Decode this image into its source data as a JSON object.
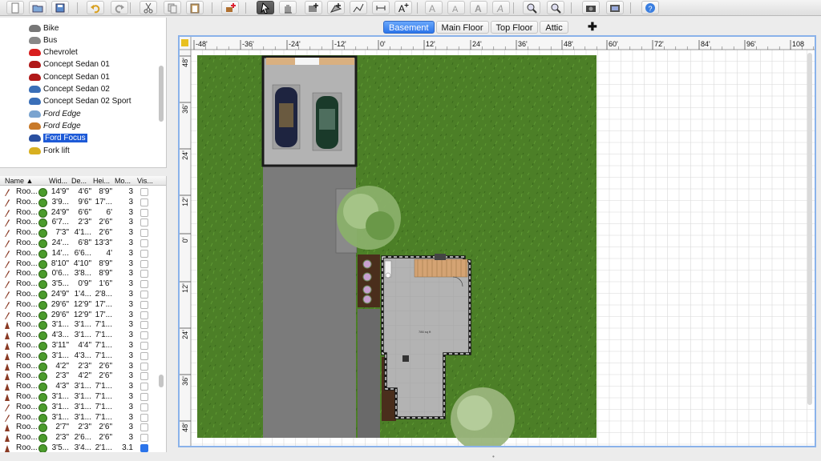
{
  "toolbar": {
    "icons": [
      "new-file-icon",
      "open-folder-icon",
      "save-icon",
      "undo-icon",
      "redo-icon",
      "cut-icon",
      "copy-icon",
      "paste-icon",
      "add-furniture-icon",
      "select-pointer-icon",
      "pan-hand-icon",
      "create-walls-icon",
      "create-rooms-icon",
      "create-polylines-icon",
      "create-dimensions-icon",
      "add-text-icon",
      "increase-text-icon",
      "decrease-text-icon",
      "bold-text-icon",
      "italic-text-icon",
      "zoom-in-icon",
      "zoom-out-icon",
      "create-photo-icon",
      "create-video-icon",
      "help-icon"
    ]
  },
  "catalog": {
    "items": [
      {
        "label": "Bike",
        "color": "#777777",
        "italic": false,
        "selected": false
      },
      {
        "label": "Bus",
        "color": "#888888",
        "italic": false,
        "selected": false
      },
      {
        "label": "Chevrolet",
        "color": "#d81e1e",
        "italic": false,
        "selected": false
      },
      {
        "label": "Concept Sedan 01",
        "color": "#b01818",
        "italic": false,
        "selected": false
      },
      {
        "label": "Concept Sedan 01",
        "color": "#b01818",
        "italic": false,
        "selected": false
      },
      {
        "label": "Concept Sedan 02",
        "color": "#3a6fb8",
        "italic": false,
        "selected": false
      },
      {
        "label": "Concept Sedan 02 Sport",
        "color": "#3a6fb8",
        "italic": false,
        "selected": false
      },
      {
        "label": "Ford Edge",
        "color": "#7aa4d0",
        "italic": true,
        "selected": false
      },
      {
        "label": "Ford Edge",
        "color": "#c87a2a",
        "italic": true,
        "selected": false
      },
      {
        "label": "Ford Focus",
        "color": "#2a50a0",
        "italic": false,
        "selected": true
      },
      {
        "label": "Fork lift",
        "color": "#d8b020",
        "italic": false,
        "selected": false
      }
    ]
  },
  "furniture": {
    "columns": [
      "Name ▲",
      "Wid...",
      "De...",
      "Hei...",
      "Mo...",
      "Vis..."
    ],
    "rows": [
      {
        "name": "Roo...",
        "w": "14'9\"",
        "d": "4'6\"",
        "h": "8'9\"",
        "m": "3",
        "v": false
      },
      {
        "name": "Roo...",
        "w": "3'9...",
        "d": "9'6\"",
        "h": "17'...",
        "m": "3",
        "v": false
      },
      {
        "name": "Roo...",
        "w": "24'9\"",
        "d": "6'6\"",
        "h": "6'",
        "m": "3",
        "v": false
      },
      {
        "name": "Roo...",
        "w": "6'7...",
        "d": "2'3\"",
        "h": "2'6\"",
        "m": "3",
        "v": false
      },
      {
        "name": "Roo...",
        "w": "7'3\"",
        "d": "4'1...",
        "h": "2'6\"",
        "m": "3",
        "v": false
      },
      {
        "name": "Roo...",
        "w": "24'...",
        "d": "6'8\"",
        "h": "13'3\"",
        "m": "3",
        "v": false
      },
      {
        "name": "Roo...",
        "w": "14'...",
        "d": "6'6...",
        "h": "4'",
        "m": "3",
        "v": false
      },
      {
        "name": "Roo...",
        "w": "8'10\"",
        "d": "4'10\"",
        "h": "8'9\"",
        "m": "3",
        "v": false
      },
      {
        "name": "Roo...",
        "w": "0'6...",
        "d": "3'8...",
        "h": "8'9\"",
        "m": "3",
        "v": false
      },
      {
        "name": "Roo...",
        "w": "3'5...",
        "d": "0'9\"",
        "h": "1'6\"",
        "m": "3",
        "v": false
      },
      {
        "name": "Roo...",
        "w": "24'9\"",
        "d": "1'4...",
        "h": "2'8...",
        "m": "3",
        "v": false
      },
      {
        "name": "Roo...",
        "w": "29'6\"",
        "d": "12'9\"",
        "h": "17'...",
        "m": "3",
        "v": false
      },
      {
        "name": "Roo...",
        "w": "29'6\"",
        "d": "12'9\"",
        "h": "17'...",
        "m": "3",
        "v": false
      },
      {
        "name": "Roo...",
        "w": "3'1...",
        "d": "3'1...",
        "h": "7'1...",
        "m": "3",
        "v": false
      },
      {
        "name": "Roo...",
        "w": "4'3...",
        "d": "3'1...",
        "h": "7'1...",
        "m": "3",
        "v": false
      },
      {
        "name": "Roo...",
        "w": "3'11\"",
        "d": "4'4\"",
        "h": "7'1...",
        "m": "3",
        "v": false
      },
      {
        "name": "Roo...",
        "w": "3'1...",
        "d": "4'3...",
        "h": "7'1...",
        "m": "3",
        "v": false
      },
      {
        "name": "Roo...",
        "w": "4'2\"",
        "d": "2'3\"",
        "h": "2'6\"",
        "m": "3",
        "v": false
      },
      {
        "name": "Roo...",
        "w": "2'3\"",
        "d": "4'2\"",
        "h": "2'6\"",
        "m": "3",
        "v": false
      },
      {
        "name": "Roo...",
        "w": "4'3\"",
        "d": "3'1...",
        "h": "7'1...",
        "m": "3",
        "v": false
      },
      {
        "name": "Roo...",
        "w": "3'1...",
        "d": "3'1...",
        "h": "7'1...",
        "m": "3",
        "v": false
      },
      {
        "name": "Roo...",
        "w": "3'1...",
        "d": "3'1...",
        "h": "7'1...",
        "m": "3",
        "v": false
      },
      {
        "name": "Roo...",
        "w": "3'1...",
        "d": "3'1...",
        "h": "7'1...",
        "m": "3",
        "v": false
      },
      {
        "name": "Roo...",
        "w": "2'7\"",
        "d": "2'3\"",
        "h": "2'6\"",
        "m": "3",
        "v": false
      },
      {
        "name": "Roo...",
        "w": "2'3\"",
        "d": "2'6...",
        "h": "2'6\"",
        "m": "3",
        "v": false
      },
      {
        "name": "Roo...",
        "w": "3'5...",
        "d": "3'4...",
        "h": "2'1...",
        "m": "3.1",
        "v": true
      }
    ]
  },
  "levels": {
    "tabs": [
      {
        "label": "Basement",
        "active": true
      },
      {
        "label": "Main Floor",
        "active": false
      },
      {
        "label": "Top Floor",
        "active": false
      },
      {
        "label": "Attic",
        "active": false
      }
    ],
    "add_label": "✚"
  },
  "plan": {
    "ruler_x": [
      "-48'",
      "-36'",
      "-24'",
      "-12'",
      "0'",
      "12'",
      "24'",
      "36'",
      "48'",
      "60'",
      "72'",
      "84'",
      "96'",
      "108"
    ],
    "ruler_y": [
      "48'",
      "36'",
      "24'",
      "12'",
      "0'",
      "12'",
      "24'",
      "36'",
      "48'"
    ],
    "room_label": "786 sq ft",
    "colors": {
      "grass": "#4c7f27",
      "driveway": "#7b7b7b",
      "floor": "#b3b3b3",
      "wall": "#1a1a1a",
      "grid": "#d8d8d8"
    }
  }
}
